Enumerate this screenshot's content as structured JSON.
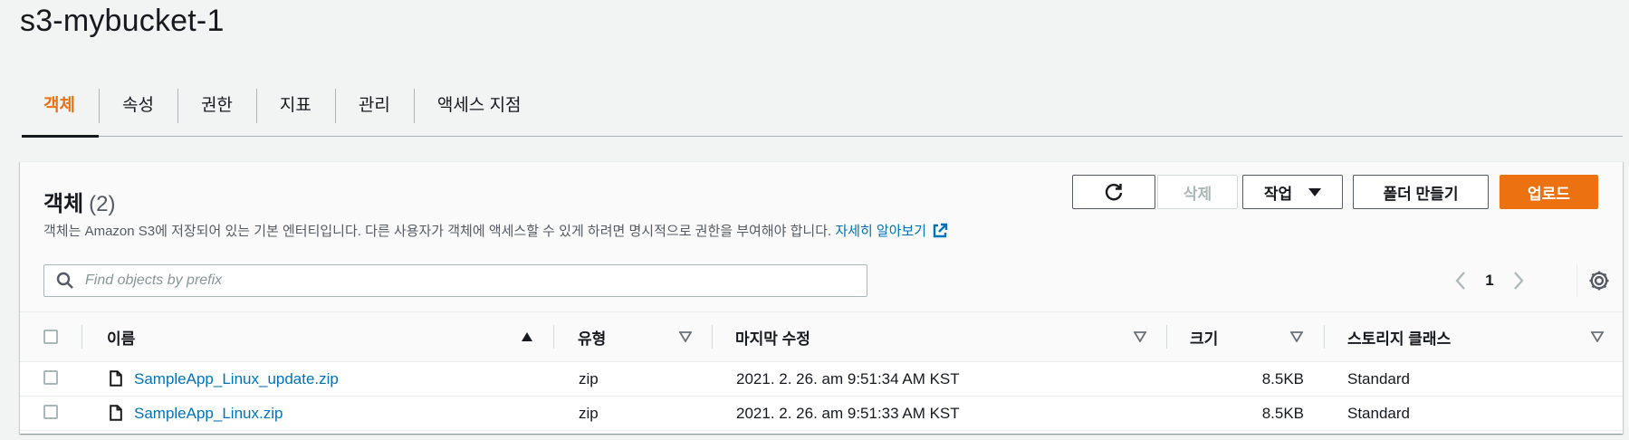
{
  "page": {
    "title": "s3-mybucket-1"
  },
  "tabs": [
    {
      "label": "객체",
      "active": true
    },
    {
      "label": "속성",
      "active": false
    },
    {
      "label": "권한",
      "active": false
    },
    {
      "label": "지표",
      "active": false
    },
    {
      "label": "관리",
      "active": false
    },
    {
      "label": "액세스 지점",
      "active": false
    }
  ],
  "objects_panel": {
    "title": "객체",
    "count": "(2)",
    "description": "객체는 Amazon S3에 저장되어 있는 기본 엔터티입니다. 다른 사용자가 객체에 액세스할 수 있게 하려면 명시적으로 권한을 부여해야 합니다.",
    "learn_more_label": "자세히 알아보기",
    "buttons": {
      "refresh_icon": "refresh-icon",
      "delete_label": "삭제",
      "actions_label": "작업",
      "create_folder_label": "폴더 만들기",
      "upload_label": "업로드"
    },
    "search": {
      "placeholder": "Find objects by prefix",
      "value": ""
    },
    "pagination": {
      "current_page": "1"
    },
    "table": {
      "columns": [
        "이름",
        "유형",
        "마지막 수정",
        "크기",
        "스토리지 클래스"
      ],
      "rows": [
        {
          "name": "SampleApp_Linux_update.zip",
          "type": "zip",
          "last_modified": "2021. 2. 26. am 9:51:34 AM KST",
          "size": "8.5KB",
          "storage_class": "Standard"
        },
        {
          "name": "SampleApp_Linux.zip",
          "type": "zip",
          "last_modified": "2021. 2. 26. am 9:51:33 AM KST",
          "size": "8.5KB",
          "storage_class": "Standard"
        }
      ]
    }
  },
  "colors": {
    "accent": "#ec7211",
    "link": "#0073bb",
    "text": "#16191f",
    "muted_text": "#545b64",
    "background": "#f2f3f3"
  }
}
